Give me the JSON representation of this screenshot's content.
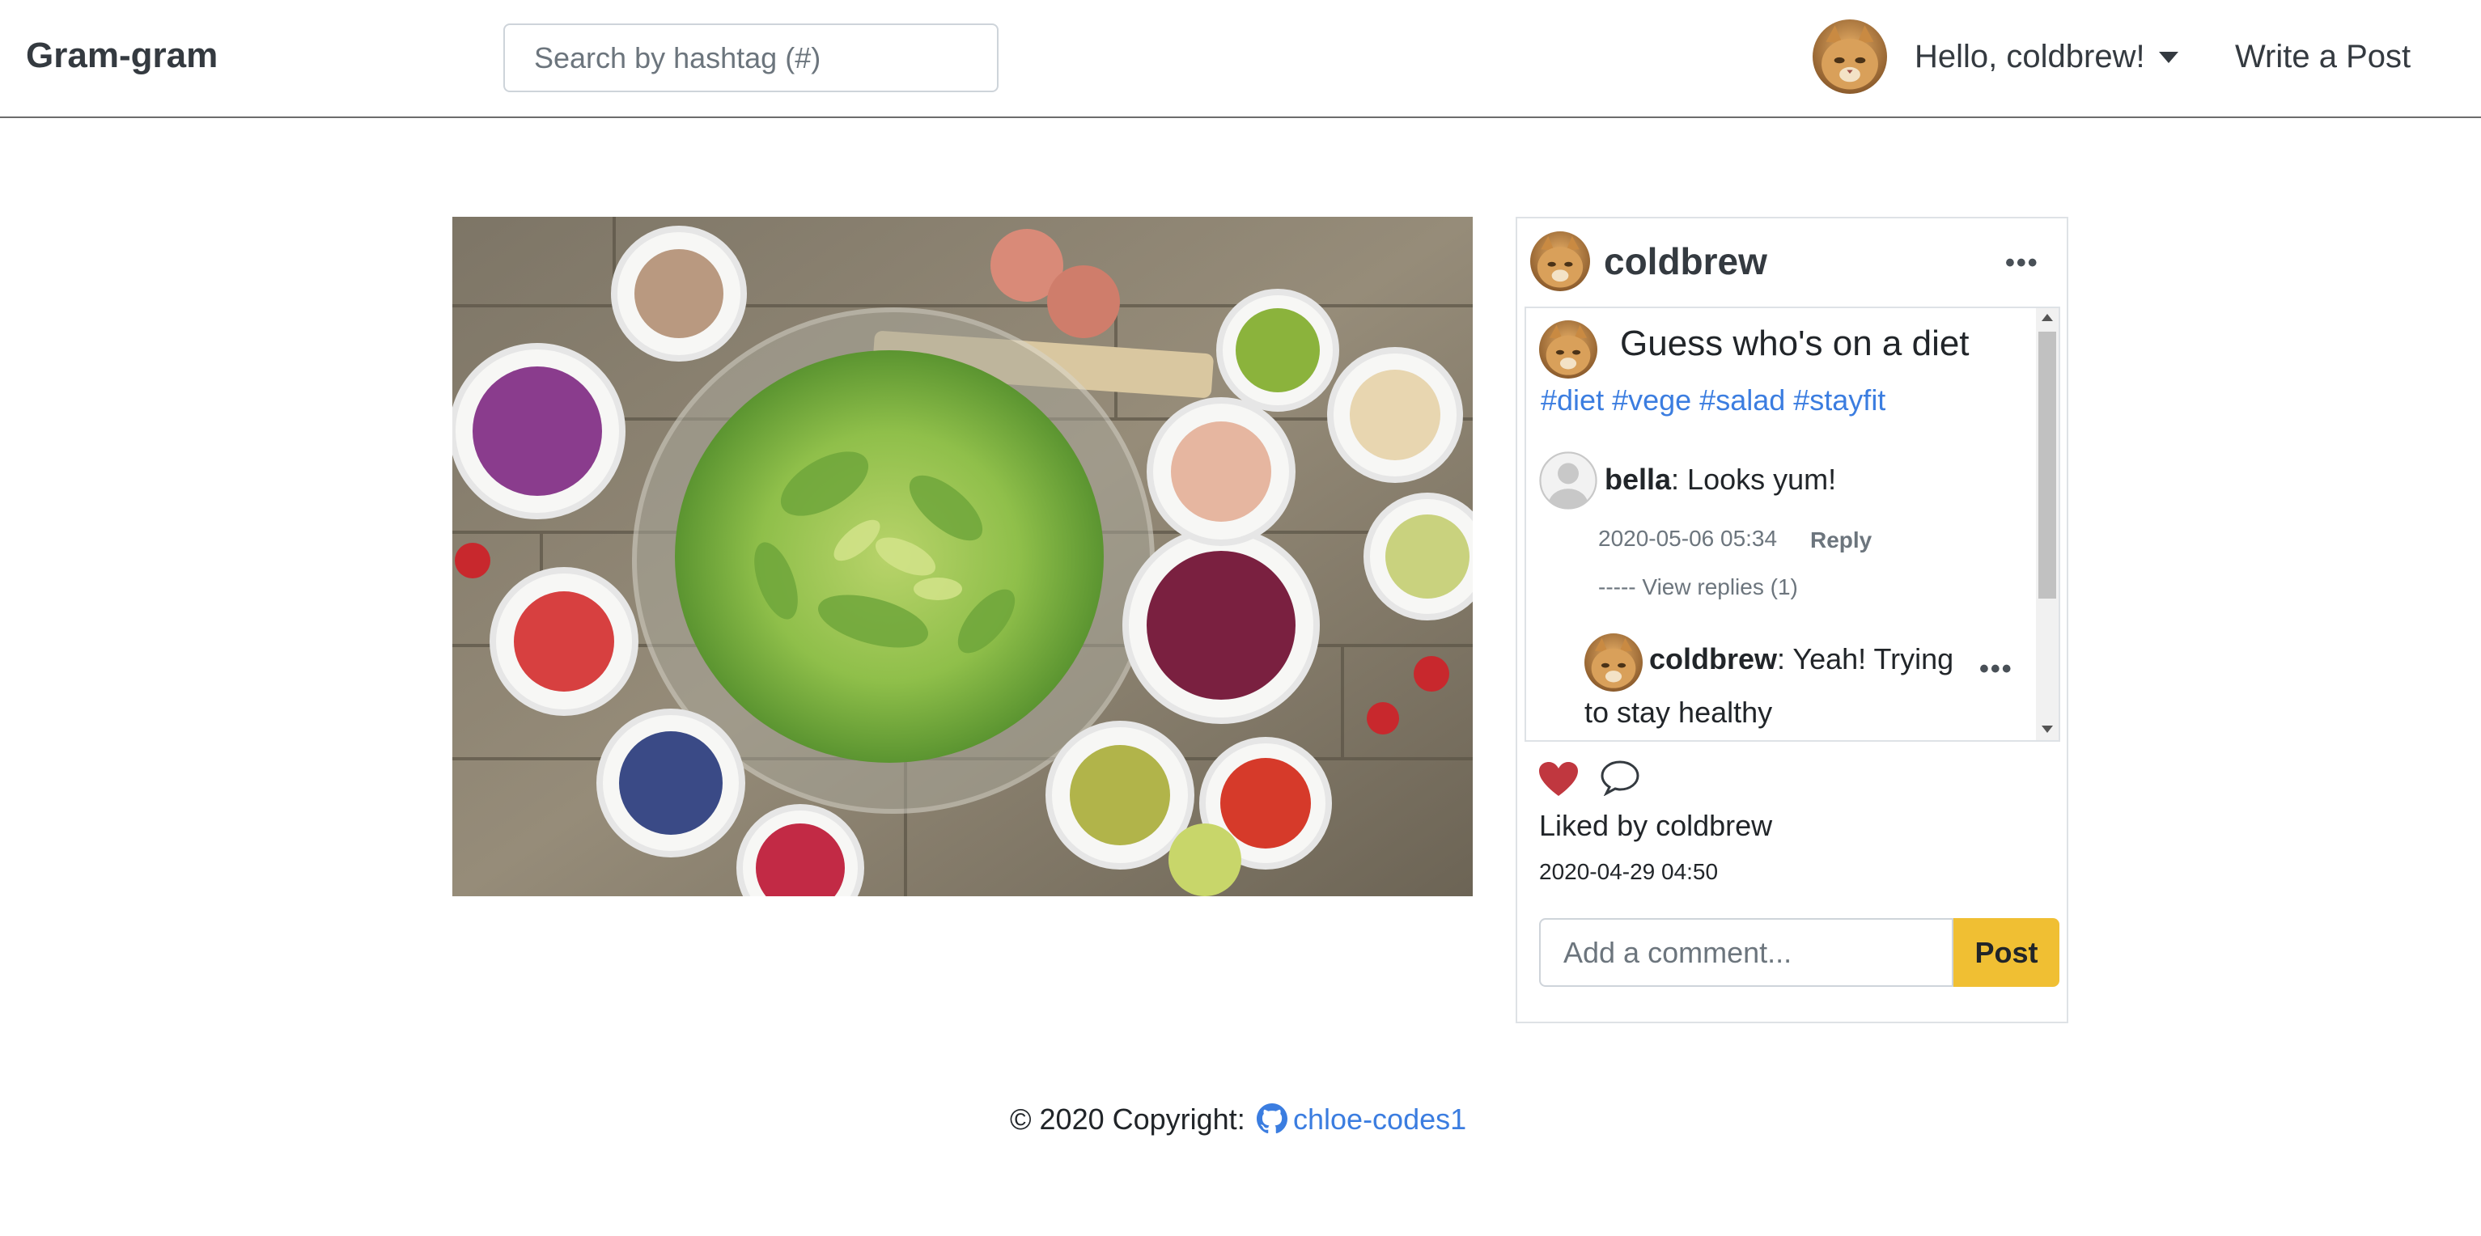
{
  "navbar": {
    "brand": "Gram-gram",
    "search_placeholder": "Search by hashtag (#)",
    "greeting": "Hello, coldbrew!",
    "write_post": "Write a Post"
  },
  "post": {
    "author": "coldbrew",
    "caption": "Guess who's on a diet",
    "hashtags": [
      "#diet",
      "#vege",
      "#salad",
      "#stayfit"
    ],
    "comments": [
      {
        "author": "bella",
        "text": ": Looks yum!",
        "timestamp": "2020-05-06 05:34",
        "reply_label": "Reply",
        "view_replies": "----- View replies (1)",
        "replies": [
          {
            "author": "coldbrew",
            "text": ": Yeah! Trying to stay healthy"
          }
        ]
      }
    ],
    "liked_by": "Liked by coldbrew",
    "date": "2020-04-29 04:50",
    "comment_placeholder": "Add a comment...",
    "post_button": "Post",
    "more_icon": "more-horizontal-icon"
  },
  "footer": {
    "copyright": "© 2020 Copyright:",
    "link_text": "chloe-codes1",
    "link_icon": "github-icon"
  },
  "colors": {
    "accent_button": "#f0bf33",
    "link": "#3b7de0",
    "heart": "#c0373f"
  }
}
